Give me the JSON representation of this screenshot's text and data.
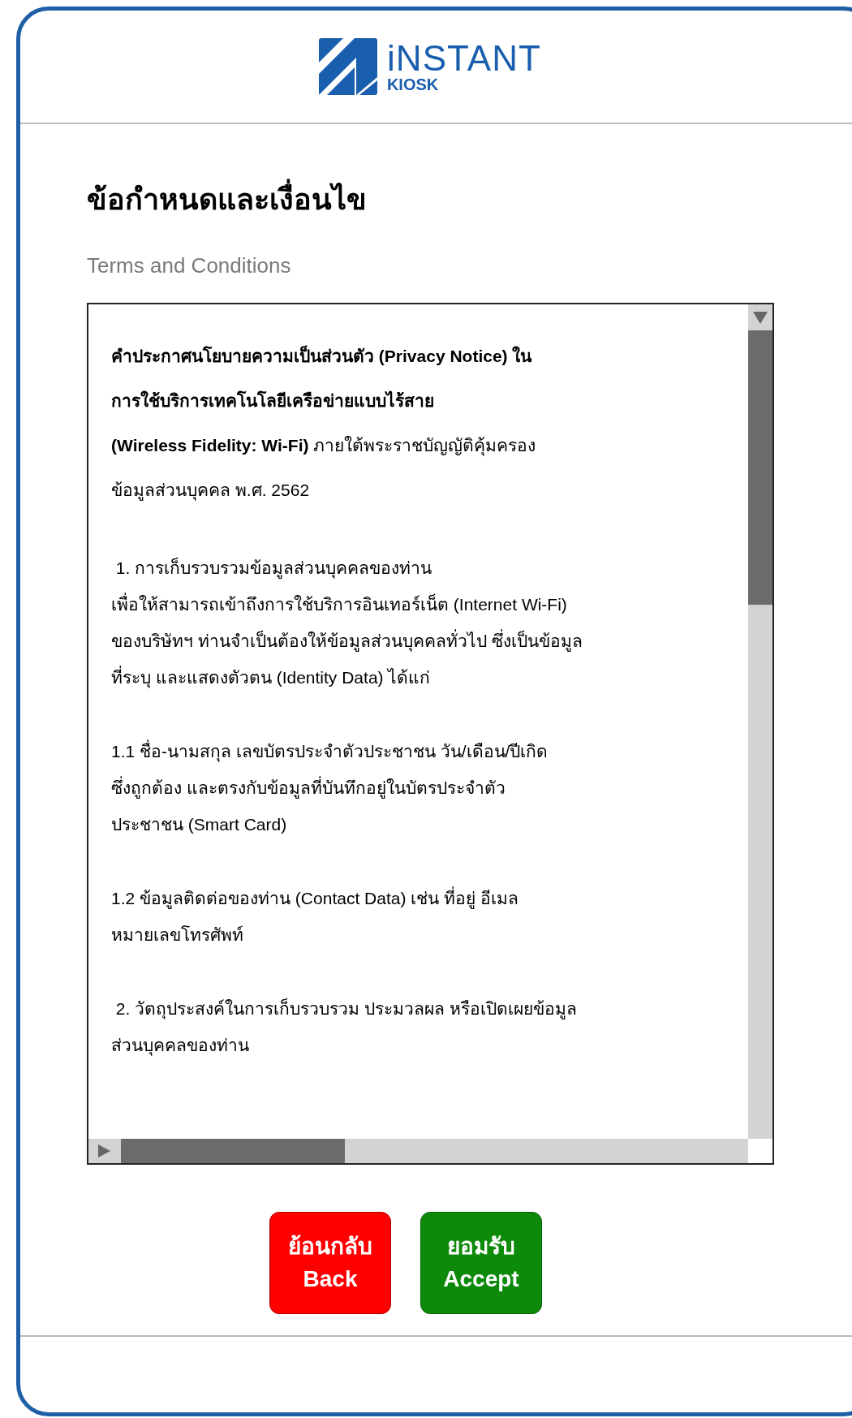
{
  "logo": {
    "word": "iNSTANT",
    "subword": "KIOSK"
  },
  "heading": "ข้อกำหนดและเงื่อนไข",
  "subheading": "Terms and Conditions",
  "document": {
    "paragraphs": [
      {
        "kind": "title",
        "lines": [
          "**คำประกาศนโยบายความเป็นส่วนตัว (Privacy Notice) ใน**",
          "**การใช้บริการเทคโนโลยีเครือข่ายแบบไร้สาย**",
          "**(Wireless Fidelity: Wi-Fi)** ภายใต้พระราชบัญญัติคุ้มครอง",
          "ข้อมูลส่วนบุคคล พ.ศ. 2562"
        ]
      },
      {
        "kind": "body",
        "lines": [
          " 1. การเก็บรวบรวมข้อมูลส่วนบุคคลของท่าน",
          "เพื่อให้สามารถเข้าถึงการใช้บริการอินเทอร์เน็ต (Internet Wi-Fi)",
          "ของบริษัทฯ ท่านจำเป็นต้องให้ข้อมูลส่วนบุคคลทั่วไป ซึ่งเป็นข้อมูล",
          "ที่ระบุ และแสดงตัวตน (Identity Data) ได้แก่"
        ]
      },
      {
        "kind": "body",
        "lines": [
          "1.1 ชื่อ-นามสกุล เลขบัตรประจำตัวประชาชน วัน/เดือน/ปีเกิด",
          "ซึ่งถูกต้อง และตรงกับข้อมูลที่บันทึกอยู่ในบัตรประจำตัว",
          "ประชาชน (Smart Card)"
        ]
      },
      {
        "kind": "body",
        "lines": [
          "1.2 ข้อมูลติดต่อของท่าน (Contact Data) เช่น ที่อยู่ อีเมล",
          "หมายเลขโทรศัพท์"
        ]
      },
      {
        "kind": "body",
        "lines": [
          " 2. วัตถุประสงค์ในการเก็บรวบรวม ประมวลผล หรือเปิดเผยข้อมูล",
          "ส่วนบุคคลของท่าน"
        ]
      }
    ]
  },
  "buttons": [
    {
      "kind": "back",
      "lines": [
        "ย้อนกลับ",
        "Back"
      ]
    },
    {
      "kind": "accept",
      "lines": [
        "ยอมรับ",
        "Accept"
      ]
    }
  ]
}
